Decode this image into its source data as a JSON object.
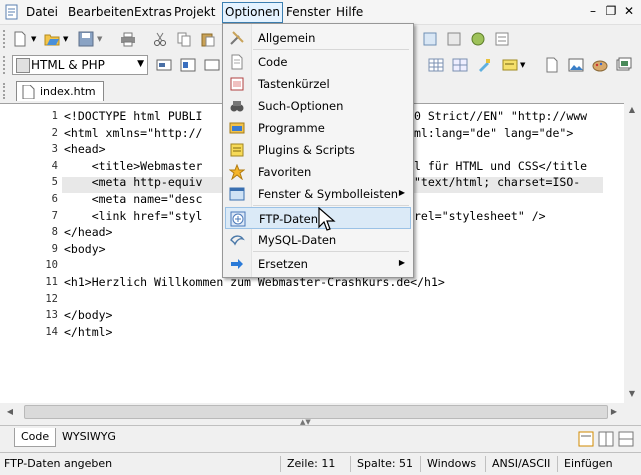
{
  "menubar": {
    "items": [
      "Datei",
      "Bearbeiten",
      "Extras",
      "Projekt",
      "Optionen",
      "Fenster",
      "Hilfe"
    ],
    "active": "Optionen"
  },
  "toolbar": {
    "doctype_combo": "HTML & PHP"
  },
  "tabs": {
    "document": "index.htm"
  },
  "editor": {
    "line_numbers": [
      "1",
      "2",
      "3",
      "4",
      "5",
      "6",
      "7",
      "8",
      "9",
      "10",
      "11",
      "12",
      "13",
      "14"
    ],
    "lines": [
      "<!DOCTYPE html PUBLI",
      "<html xmlns=\"http://",
      "<head>",
      "    <title>Webmaster",
      "    <meta http-equiv",
      "    <meta name=\"desc",
      "    <link href=\"styl",
      "</head>",
      "<body>",
      "",
      "<h1>Herzlich Willkommen zum Webmaster-Crashkurs.de</h1>",
      "",
      "</body>",
      "</html>"
    ],
    "line_tails": [
      "0 Strict//EN\" \"http://www",
      "ml:lang=\"de\" lang=\"de\">",
      "",
      "l für HTML und CSS</title",
      "\"text/html; charset=ISO-",
      "",
      "rel=\"stylesheet\" />",
      "",
      "",
      "",
      "",
      "",
      "",
      ""
    ],
    "current_line": 11
  },
  "dropdown": {
    "items": [
      {
        "label": "Allgemein",
        "icon": "tools-icon",
        "submenu": false
      },
      {
        "label": "Code",
        "icon": "page-icon",
        "submenu": false
      },
      {
        "label": "Tastenkürzel",
        "icon": "keyboard-icon",
        "submenu": false
      },
      {
        "label": "Such-Optionen",
        "icon": "binoculars-icon",
        "submenu": false
      },
      {
        "label": "Programme",
        "icon": "programs-icon",
        "submenu": false
      },
      {
        "label": "Plugins & Scripts",
        "icon": "plugin-icon",
        "submenu": false
      },
      {
        "label": "Favoriten",
        "icon": "star-icon",
        "submenu": false
      },
      {
        "label": "Fenster & Symbolleisten",
        "icon": "window-icon",
        "submenu": true
      },
      {
        "label": "FTP-Daten",
        "icon": "ftp-icon",
        "submenu": false
      },
      {
        "label": "MySQL-Daten",
        "icon": "dolphin-icon",
        "submenu": false
      },
      {
        "label": "Ersetzen",
        "icon": "arrow-right-icon",
        "submenu": true
      }
    ],
    "highlighted": "FTP-Daten"
  },
  "bottom_tabs": {
    "code": "Code",
    "wysiwyg": "WYSIWYG"
  },
  "statusbar": {
    "message": "FTP-Daten angeben",
    "line": "Zeile: 11",
    "column": "Spalte: 51",
    "line_endings": "Windows",
    "encoding": "ANSI/ASCII",
    "mode": "Einfügen"
  }
}
